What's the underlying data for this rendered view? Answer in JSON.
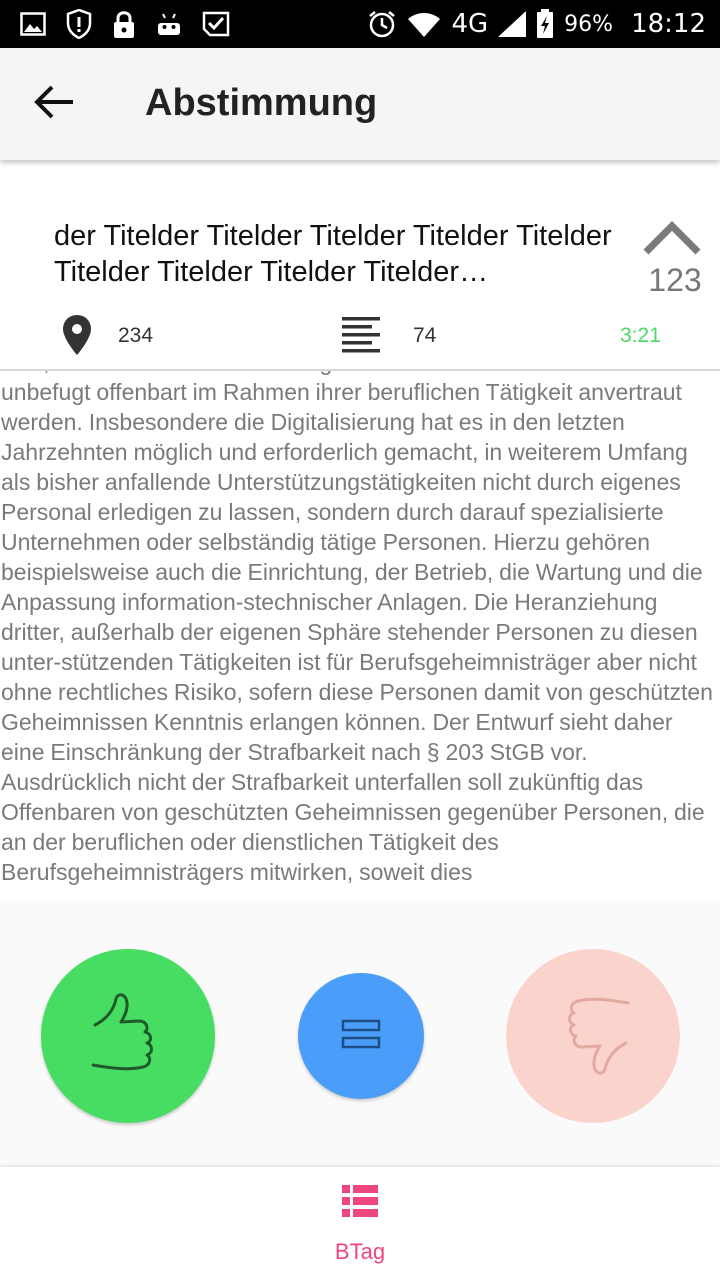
{
  "status_bar": {
    "network": "4G",
    "battery": "96%",
    "time": "18:12",
    "icons_left": [
      "image-icon",
      "shield-alert-icon",
      "lock-icon",
      "android-icon",
      "check-badge-icon"
    ],
    "icons_right": [
      "alarm-icon",
      "wifi-icon",
      "signal-icon",
      "battery-charging-icon"
    ]
  },
  "app_bar": {
    "title": "Abstimmung",
    "back_icon": "arrow-left-icon"
  },
  "item": {
    "title": "der Titelder Titelder Titelder Titelder Titelder Titelder Titelder Titelder Titelder…",
    "upvotes": "123",
    "location": "234",
    "lines": "74",
    "time": "3:21"
  },
  "body": {
    "text": "sind, die ihnen bei der Ausübung des Berufs oder sonst ist nicht unbefugt offenbart im Rahmen ihrer beruflichen Tätigkeit anvertraut werden. Insbesondere die Digitalisierung hat es in den letzten Jahrzehnten möglich und erforderlich gemacht, in weiterem Umfang als bisher anfallende Unterstützungstätigkeiten nicht durch eigenes Personal erledigen zu lassen, sondern durch darauf spezialisierte Unternehmen oder selbständig tätige Personen. Hierzu gehören beispielsweise auch die Einrichtung, der Betrieb, die Wartung und die Anpassung information-stechnischer Anlagen. Die Heranziehung dritter, außerhalb der eigenen Sphäre stehender Personen zu diesen unter-stützenden Tätigkeiten ist für Berufsgeheimnisträger aber nicht ohne rechtliches Risiko, sofern diese Personen damit von geschützten Geheimnissen Kenntnis erlangen können. Der Entwurf sieht daher eine Einschränkung der Strafbarkeit nach § 203 StGB vor. Ausdrücklich nicht der Strafbarkeit unterfallen soll zukünftig das Offenbaren von geschützten Geheimnissen gegenüber Personen, die an der beruflichen oder dienstlichen Tätigkeit des Berufsgeheimnisträgers mitwirken, soweit dies"
  },
  "vote": {
    "yes_icon": "thumbs-up-icon",
    "neutral_icon": "equals-icon",
    "no_icon": "thumbs-down-icon",
    "colors": {
      "yes": "#47dc62",
      "neutral": "#4a9df8",
      "no": "#fad3cd"
    }
  },
  "bottom_nav": {
    "items": [
      {
        "label": "BTag",
        "icon": "list-icon"
      }
    ],
    "accent": "#f0467f"
  }
}
